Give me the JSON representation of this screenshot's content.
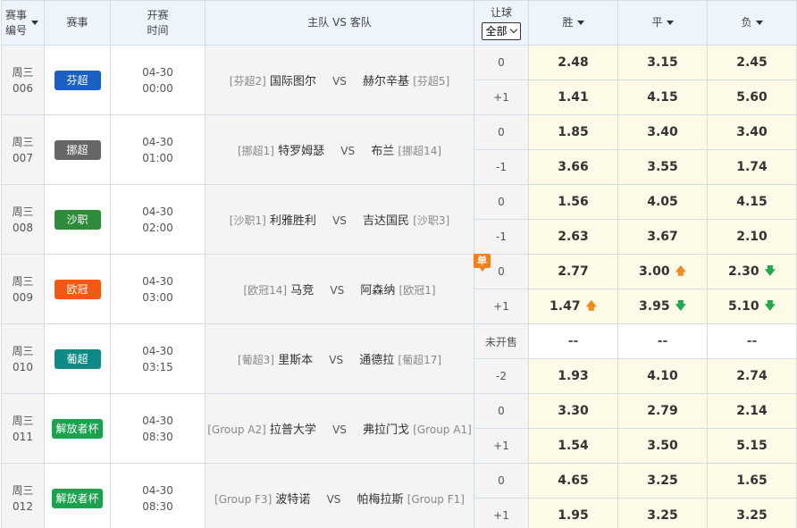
{
  "header": {
    "num": "赛事编号",
    "league": "赛事",
    "time": "开赛时间",
    "teams": "主队 VS 客队",
    "rq": "让球",
    "rq_select": "全部",
    "win": "胜",
    "draw": "平",
    "lose": "负"
  },
  "matches": [
    {
      "day": "周三",
      "no": "006",
      "league": "芬超",
      "league_color": "#1a5fc3",
      "date": "04-30",
      "time": "00:00",
      "home_tag": "[芬超2]",
      "home": "国际图尔",
      "vs": "VS",
      "away": "赫尔辛基",
      "away_tag": "[芬超5]",
      "badge": "",
      "rows": [
        {
          "rq": "0",
          "w": "2.48",
          "d": "3.15",
          "l": "2.45",
          "wa": "",
          "da": "",
          "la": ""
        },
        {
          "rq": "+1",
          "w": "1.41",
          "d": "4.15",
          "l": "5.60",
          "wa": "",
          "da": "",
          "la": ""
        }
      ]
    },
    {
      "day": "周三",
      "no": "007",
      "league": "挪超",
      "league_color": "#666666",
      "date": "04-30",
      "time": "01:00",
      "home_tag": "[挪超1]",
      "home": "特罗姆瑟",
      "vs": "VS",
      "away": "布兰",
      "away_tag": "[挪超14]",
      "badge": "",
      "rows": [
        {
          "rq": "0",
          "w": "1.85",
          "d": "3.40",
          "l": "3.40",
          "wa": "",
          "da": "",
          "la": ""
        },
        {
          "rq": "-1",
          "w": "3.66",
          "d": "3.55",
          "l": "1.74",
          "wa": "",
          "da": "",
          "la": ""
        }
      ]
    },
    {
      "day": "周三",
      "no": "008",
      "league": "沙职",
      "league_color": "#2e8b3a",
      "date": "04-30",
      "time": "02:00",
      "home_tag": "[沙职1]",
      "home": "利雅胜利",
      "vs": "VS",
      "away": "吉达国民",
      "away_tag": "[沙职3]",
      "badge": "",
      "rows": [
        {
          "rq": "0",
          "w": "1.56",
          "d": "4.05",
          "l": "4.15",
          "wa": "",
          "da": "",
          "la": ""
        },
        {
          "rq": "-1",
          "w": "2.63",
          "d": "3.67",
          "l": "2.10",
          "wa": "",
          "da": "",
          "la": ""
        }
      ]
    },
    {
      "day": "周三",
      "no": "009",
      "league": "欧冠",
      "league_color": "#f25a14",
      "date": "04-30",
      "time": "03:00",
      "home_tag": "[欧冠14]",
      "home": "马竞",
      "vs": "VS",
      "away": "阿森纳",
      "away_tag": "[欧冠1]",
      "badge": "单",
      "rows": [
        {
          "rq": "0",
          "w": "2.77",
          "d": "3.00",
          "l": "2.30",
          "wa": "",
          "da": "up",
          "la": "down"
        },
        {
          "rq": "+1",
          "w": "1.47",
          "d": "3.95",
          "l": "5.10",
          "wa": "up",
          "da": "down",
          "la": "down"
        }
      ]
    },
    {
      "day": "周三",
      "no": "010",
      "league": "葡超",
      "league_color": "#0f8a86",
      "date": "04-30",
      "time": "03:15",
      "home_tag": "[葡超3]",
      "home": "里斯本",
      "vs": "VS",
      "away": "通德拉",
      "away_tag": "[葡超17]",
      "badge": "",
      "rows": [
        {
          "rq": "未开售",
          "w": "--",
          "d": "--",
          "l": "--",
          "wa": "",
          "da": "",
          "la": ""
        },
        {
          "rq": "-2",
          "w": "1.93",
          "d": "4.10",
          "l": "2.74",
          "wa": "",
          "da": "",
          "la": ""
        }
      ]
    },
    {
      "day": "周三",
      "no": "011",
      "league": "解放者杯",
      "league_color": "#1ea14f",
      "date": "04-30",
      "time": "08:30",
      "home_tag": "[Group A2]",
      "home": "拉普大学",
      "vs": "VS",
      "away": "弗拉门戈",
      "away_tag": "[Group A1]",
      "badge": "",
      "rows": [
        {
          "rq": "0",
          "w": "3.30",
          "d": "2.79",
          "l": "2.14",
          "wa": "",
          "da": "",
          "la": ""
        },
        {
          "rq": "+1",
          "w": "1.54",
          "d": "3.50",
          "l": "5.15",
          "wa": "",
          "da": "",
          "la": ""
        }
      ]
    },
    {
      "day": "周三",
      "no": "012",
      "league": "解放者杯",
      "league_color": "#1ea14f",
      "date": "04-30",
      "time": "08:30",
      "home_tag": "[Group F3]",
      "home": "波特诺",
      "vs": "VS",
      "away": "帕梅拉斯",
      "away_tag": "[Group F1]",
      "badge": "",
      "rows": [
        {
          "rq": "0",
          "w": "4.65",
          "d": "3.25",
          "l": "1.65",
          "wa": "",
          "da": "",
          "la": ""
        },
        {
          "rq": "+1",
          "w": "1.95",
          "d": "3.25",
          "l": "3.25",
          "wa": "",
          "da": "",
          "la": ""
        }
      ]
    }
  ]
}
